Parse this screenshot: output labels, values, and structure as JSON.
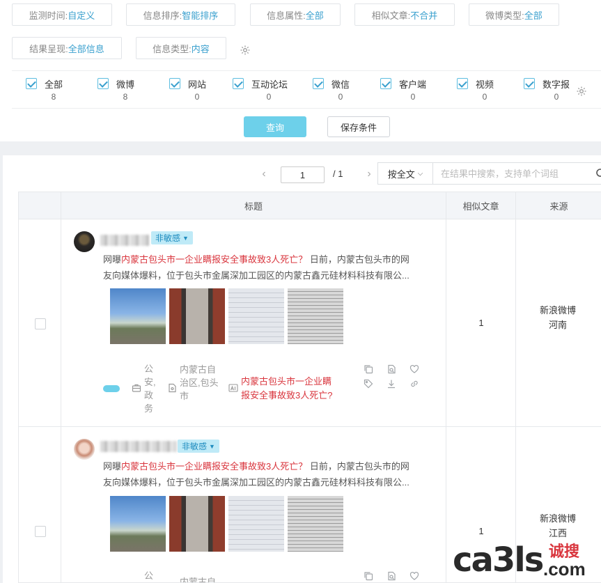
{
  "filters": {
    "monitor_time": {
      "label": "监测时间:",
      "value": "自定义"
    },
    "sort": {
      "label": "信息排序:",
      "value": "智能排序"
    },
    "attribute": {
      "label": "信息属性:",
      "value": "全部"
    },
    "similar": {
      "label": "相似文章:",
      "value": "不合并"
    },
    "weibo_type": {
      "label": "微博类型:",
      "value": "全部"
    },
    "display": {
      "label": "结果呈现:",
      "value": "全部信息"
    },
    "info_type": {
      "label": "信息类型:",
      "value": "内容"
    }
  },
  "source_types": [
    {
      "name": "全部",
      "count": "8"
    },
    {
      "name": "微博",
      "count": "8"
    },
    {
      "name": "网站",
      "count": "0"
    },
    {
      "name": "互动论坛",
      "count": "0"
    },
    {
      "name": "微信",
      "count": "0"
    },
    {
      "name": "客户端",
      "count": "0"
    },
    {
      "name": "视频",
      "count": "0"
    },
    {
      "name": "数字报",
      "count": "0"
    }
  ],
  "buttons": {
    "query": "查询",
    "save": "保存条件"
  },
  "pager": {
    "current": "1",
    "total": "/ 1",
    "prev": "‹",
    "next": "›"
  },
  "search": {
    "mode": "按全文",
    "placeholder": "在结果中搜索，支持单个词组"
  },
  "table": {
    "headers": {
      "title": "标题",
      "similar": "相似文章",
      "source": "来源"
    }
  },
  "rows": [
    {
      "badge": "非敏感",
      "snippet_prefix": "网曝",
      "snippet_highlight": "内蒙古包头市一企业瞒报安全事故致3人死亡？",
      "snippet_rest": " 日前，内蒙古包头市的网",
      "snippet_line2": "友向媒体爆料，位于包头市金属深加工园区的内蒙古鑫元硅材料科技有限公...",
      "category": "公安,政务",
      "region": "内蒙古自治区,包头市",
      "headline": "内蒙古包头市一企业瞒报安全事故致3人死亡?",
      "similar_count": "1",
      "source_site": "新浪微博",
      "source_region": "河南"
    },
    {
      "badge": "非敏感",
      "snippet_prefix": "网曝",
      "snippet_highlight": "内蒙古包头市一企业瞒报安全事故致3人死亡？",
      "snippet_rest": " 日前，内蒙古包头市的网",
      "snippet_line2": "友向媒体爆料，位于包头市金属深加工园区的内蒙古鑫元硅材料科技有限公...",
      "category": "公安",
      "region": "内蒙古自",
      "similar_count": "1",
      "source_site": "新浪微博",
      "source_region": "江西"
    }
  ],
  "watermark": {
    "mark": "ca3ls",
    "cn": "诚搜",
    "com": ".com"
  }
}
